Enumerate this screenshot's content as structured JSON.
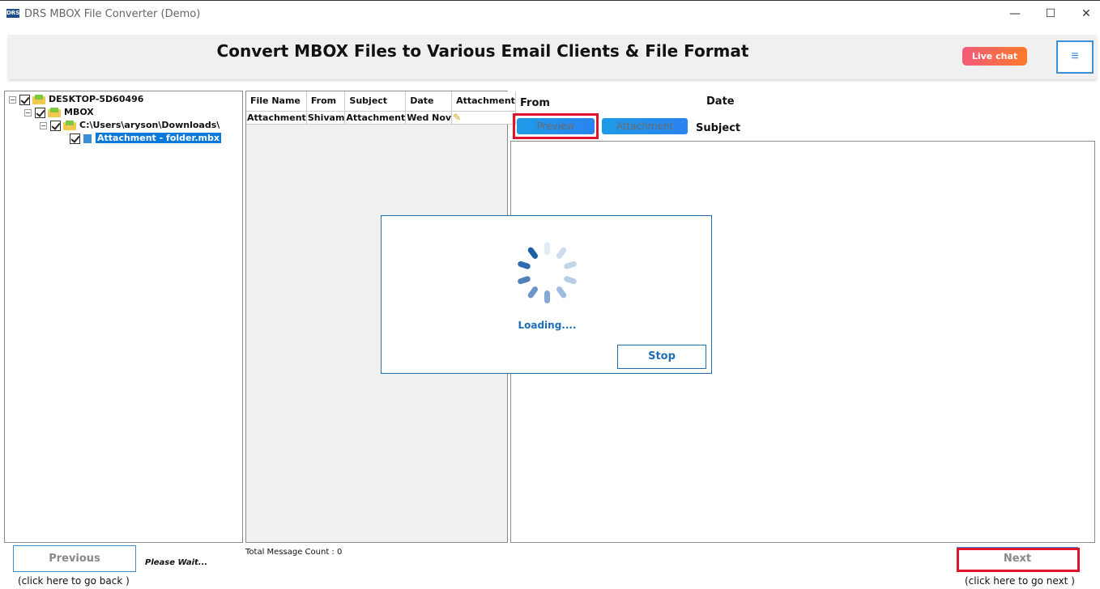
{
  "window": {
    "icon_text": "DRS",
    "title": "DRS MBOX File Converter (Demo)",
    "minimize": "—",
    "maximize": "☐",
    "close": "✕"
  },
  "header": {
    "title": "Convert MBOX Files to Various Email Clients & File Format",
    "live_chat": "Live chat",
    "menu_icon": "≡"
  },
  "tree": {
    "items": [
      {
        "label": "DESKTOP-5D60496"
      },
      {
        "label": "MBOX"
      },
      {
        "label": "C:\\Users\\aryson\\Downloads\\"
      },
      {
        "label": "Attachment - folder.mbx"
      }
    ]
  },
  "message_list": {
    "columns": [
      "File Name",
      "From",
      "Subject",
      "Date",
      "Attachment"
    ],
    "rows": [
      {
        "file_name": "Attachment",
        "from": "Shivam",
        "subject": "Attachment",
        "date": "Wed Nov",
        "attachment_icon": "paperclip-icon"
      }
    ],
    "total_label": "Total Message Count : 0"
  },
  "preview": {
    "from_label": "From",
    "date_label": "Date",
    "subject_label": "Subject",
    "preview_tab": "Preview",
    "attachment_tab": "Attachment"
  },
  "modal": {
    "loading_text": "Loading....",
    "stop_label": "Stop"
  },
  "nav": {
    "previous_label": "Previous",
    "previous_hint": "(click here to  go back )",
    "status": "Please Wait...",
    "next_label": "Next",
    "next_hint": "(click here to  go next )"
  },
  "colors": {
    "accent": "#1f6fb6",
    "highlight_red": "#e0142c",
    "live_chat_start": "#f25a7a",
    "live_chat_end": "#ff7a2a"
  }
}
